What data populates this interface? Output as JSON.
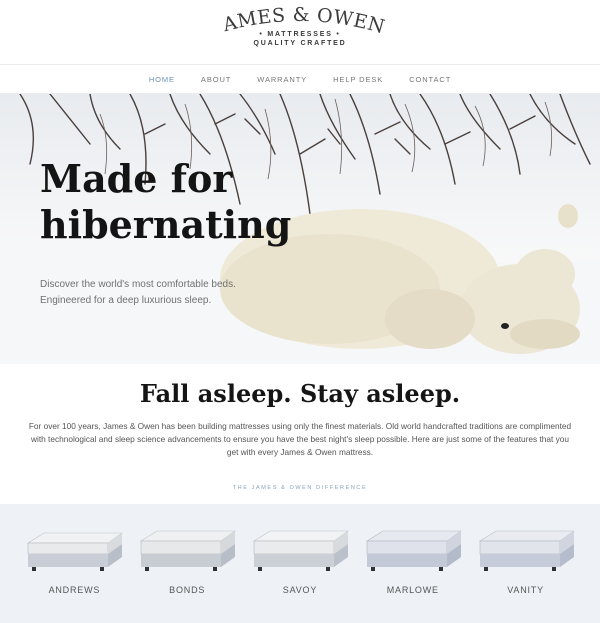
{
  "brand": {
    "name": "JAMES & OWEN",
    "subline1": "• MATTRESSES •",
    "subline2": "QUALITY CRAFTED"
  },
  "nav": {
    "items": [
      {
        "label": "HOME",
        "active": true
      },
      {
        "label": "ABOUT",
        "active": false
      },
      {
        "label": "WARRANTY",
        "active": false
      },
      {
        "label": "HELP DESK",
        "active": false
      },
      {
        "label": "CONTACT",
        "active": false
      }
    ]
  },
  "hero": {
    "title": "Made for hibernating",
    "text": "Discover the world's most comfortable beds. Engineered for a deep luxurious sleep."
  },
  "intro": {
    "title": "Fall asleep. Stay asleep.",
    "text": "For over 100 years, James & Owen has been building mattresses using only the finest materials. Old world handcrafted traditions are complimented with technological and sleep science advancements to ensure you have the best night's sleep possible. Here are just some of the features that you get with every James & Owen mattress."
  },
  "difference": {
    "label": "THE JAMES & OWEN DIFFERENCE"
  },
  "products": [
    {
      "name": "ANDREWS"
    },
    {
      "name": "BONDS"
    },
    {
      "name": "SAVOY"
    },
    {
      "name": "MARLOWE"
    },
    {
      "name": "VANITY"
    }
  ],
  "colors": {
    "nav_active": "#6a93b8",
    "products_bg": "#eef2f6",
    "accent_label": "#8aa3bd"
  }
}
